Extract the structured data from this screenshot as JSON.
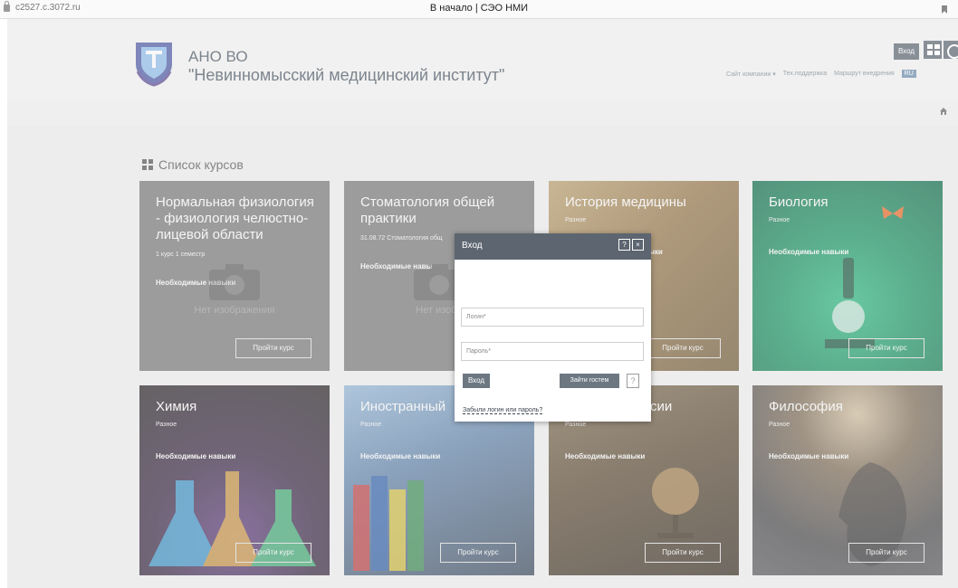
{
  "browser": {
    "url": "c2527.c.3072.ru",
    "tab_title": "В начало | СЭО НМИ"
  },
  "header": {
    "brand_line1": "АНО ВО",
    "brand_line2": "\"Невинномысский медицинский институт\"",
    "login_label": "Вход",
    "nav": [
      "Сайт компании ▾",
      "Тех.поддержка",
      "Маршрут внедрения"
    ],
    "lang": "RU"
  },
  "section": {
    "title": "Список курсов"
  },
  "cards": [
    {
      "title": "Нормальная физиология - физиология челюстно-лицевой области",
      "meta": "1 курс 1 семестр",
      "skills": "Необходимые навыки",
      "noimg": "Нет изображения",
      "button": "Пройти курс"
    },
    {
      "title": "Стоматология общей практики",
      "meta": "31.08.72 Стоматология общ",
      "skills": "Необходимые навы",
      "noimg": "Нет изобр",
      "button": ""
    },
    {
      "title": "История медицины",
      "meta": "Разное",
      "skills": "ыки",
      "button": "Пройти курс"
    },
    {
      "title": "Биология",
      "meta": "Разное",
      "skills": "Необходимые навыки",
      "button": "Пройти курс"
    },
    {
      "title": "Химия",
      "meta": "Разное",
      "skills": "Необходимые навыки",
      "button": "Пройти курс"
    },
    {
      "title": "Иностранный",
      "meta": "Разное",
      "skills": "Необходимые навыки",
      "button": "Пройти курс"
    },
    {
      "title": "сии",
      "meta": "Разное",
      "skills": "Необходимые навыки",
      "button": "Пройти курс"
    },
    {
      "title": "Философия",
      "meta": "Разное",
      "skills": "Необходимые навыки",
      "button": "Пройти курс"
    }
  ],
  "modal": {
    "title": "Вход",
    "help_icon": "?",
    "close_icon": "×",
    "login_placeholder": "Логин*",
    "password_placeholder": "Пароль*",
    "login_button": "Вход",
    "guest_button": "Зайти гостем",
    "guest_help": "?",
    "forgot_link": "Забыли логин или пароль?"
  }
}
